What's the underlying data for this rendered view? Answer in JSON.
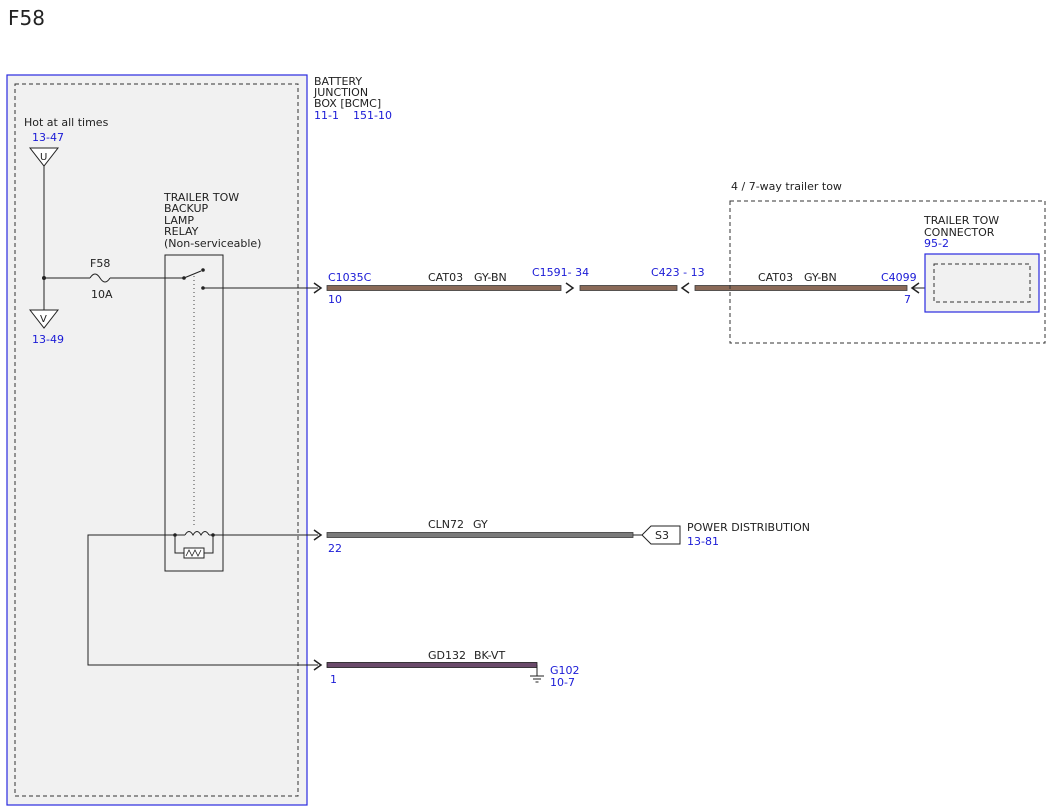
{
  "page": {
    "title": "F58"
  },
  "colors": {
    "link_blue": "#1a1ad6",
    "box_blue": "#2a2ae0",
    "wire_brown": "#8a6a58",
    "wire_grey": "#7a7a7a",
    "wire_dark": "#2a2030"
  },
  "bjb": {
    "line1": "BATTERY",
    "line2": "JUNCTION",
    "line3": "BOX [BCMC]",
    "ref1": "11-1",
    "ref2": "151-10"
  },
  "power": {
    "hot_label": "Hot at all times",
    "ref_u": "13-47",
    "u_label": "U",
    "ref_v": "13-49",
    "v_label": "V"
  },
  "fuse": {
    "name": "F58",
    "rating": "10A"
  },
  "relay": {
    "line1": "TRAILER TOW",
    "line2": "BACKUP",
    "line3": "LAMP",
    "line4": "RELAY",
    "line5": "(Non-serviceable)"
  },
  "circuit1": {
    "connector": "C1035C",
    "pin": "10",
    "wire": "CAT03",
    "color": "GY-BN",
    "inline_a": "C1591- 34",
    "inline_b": "C423 -  13",
    "wire2": "CAT03",
    "color2": "GY-BN",
    "dest_connector": "C4099",
    "dest_pin": "7"
  },
  "trailer": {
    "area_label": "4 / 7-way trailer tow",
    "line1": "TRAILER TOW",
    "line2": "CONNECTOR",
    "ref": "95-2"
  },
  "circuit2": {
    "pin": "22",
    "wire": "CLN72",
    "color": "GY",
    "splice": "S3",
    "dest": "POWER DISTRIBUTION",
    "ref": "13-81"
  },
  "circuit3": {
    "pin": "1",
    "wire": "GD132",
    "color": "BK-VT",
    "ground": "G102",
    "ref": "10-7"
  }
}
